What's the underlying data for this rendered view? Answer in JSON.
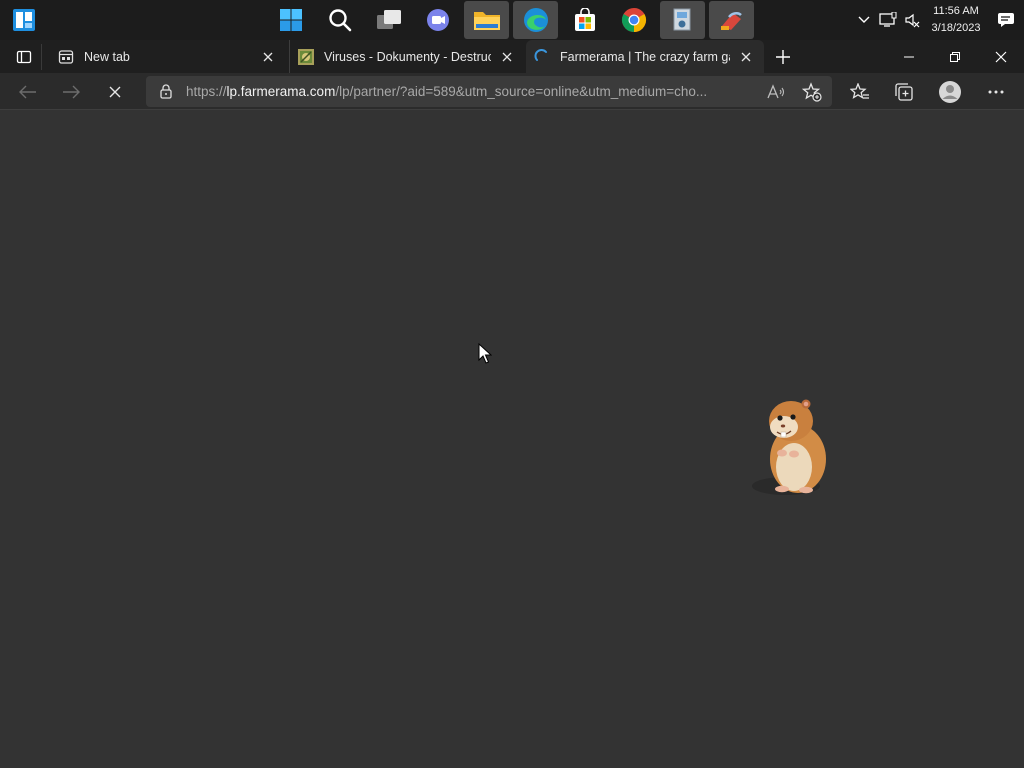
{
  "taskbar": {
    "icons": [
      "windows-start-icon",
      "search-icon",
      "task-view-icon",
      "teams-chat-icon",
      "file-explorer-icon",
      "edge-icon",
      "store-icon",
      "chrome-icon",
      "installer-icon",
      "ccleaner-icon"
    ],
    "clock_time": "11:56 AM",
    "clock_date": "3/18/2023"
  },
  "tabs": [
    {
      "title": "New tab",
      "favicon": "new-tab-icon"
    },
    {
      "title": "Viruses - Dokumenty - Destructio",
      "favicon": "site-icon"
    },
    {
      "title": "Farmerama | The crazy farm gam",
      "favicon": "loading-spinner-icon",
      "active": true
    }
  ],
  "address_bar": {
    "scheme": "https://",
    "host": "lp.farmerama.com",
    "path": "/lp/partner/?aid=589&utm_source=online&utm_medium=cho..."
  },
  "colors": {
    "taskbar_bg": "#1c1c1c",
    "tabstrip_bg": "#1f1f1f",
    "toolbar_bg": "#2b2b2b",
    "content_bg": "#333333",
    "accent_blue": "#3a96dd"
  }
}
